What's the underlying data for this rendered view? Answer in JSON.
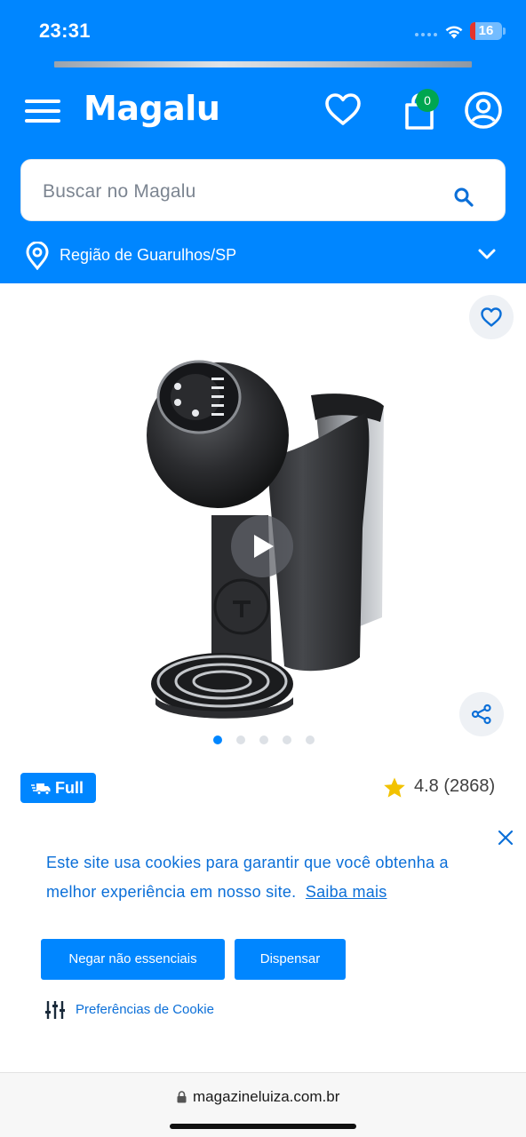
{
  "status_bar": {
    "time": "23:31",
    "battery": "16",
    "battery_level": 0.16,
    "icons": [
      "cellular-dots-icon",
      "wifi-icon",
      "battery-icon"
    ]
  },
  "header": {
    "logo": "Magalu",
    "cart_count": "0",
    "icons": [
      "menu-icon",
      "heart-icon",
      "shopping-bag-icon",
      "user-icon"
    ]
  },
  "search": {
    "placeholder": "Buscar no Magalu"
  },
  "region": {
    "label": "Região de Guarulhos/SP"
  },
  "gallery": {
    "total_images": 5,
    "active_index": 0,
    "has_video": true
  },
  "product": {
    "badge": "Full",
    "rating": "4.8 (2868)"
  },
  "cookie_banner": {
    "text": "Este site usa cookies para garantir que você obtenha a melhor experiência em nosso site.",
    "link": "Saiba mais",
    "deny_label": "Negar não essenciais",
    "dismiss_label": "Dispensar",
    "preferences_label": "Preferências de Cookie"
  },
  "browser": {
    "url": "magazineluiza.com.br"
  },
  "colors": {
    "brand_blue": "#0086ff",
    "badge_green": "#00a650",
    "star_yellow": "#f2c200",
    "link_blue": "#0b6fd8"
  }
}
